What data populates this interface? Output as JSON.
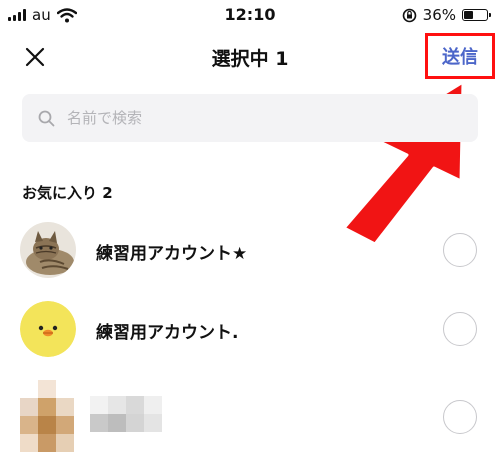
{
  "status_bar": {
    "carrier": "au",
    "time": "12:10",
    "battery_text": "36%",
    "battery_level": 0.36
  },
  "header": {
    "title": "選択中 1",
    "send_label": "送信",
    "close_icon": "close-icon"
  },
  "search": {
    "placeholder": "名前で検索",
    "icon": "search-icon"
  },
  "favorites": {
    "title": "お気に入り 2",
    "items": [
      {
        "name": "練習用アカウント★",
        "avatar": "cat-photo",
        "selected": false
      },
      {
        "name": "練習用アカウント.",
        "avatar": "chick-character",
        "selected": false
      },
      {
        "name": "",
        "avatar": "pixelated-photo",
        "selected": false
      }
    ]
  },
  "colors": {
    "accent": "#4c66c9",
    "highlight": "#ff1010",
    "search_bg": "#f3f3f5",
    "chick_yellow": "#f3e45a"
  }
}
